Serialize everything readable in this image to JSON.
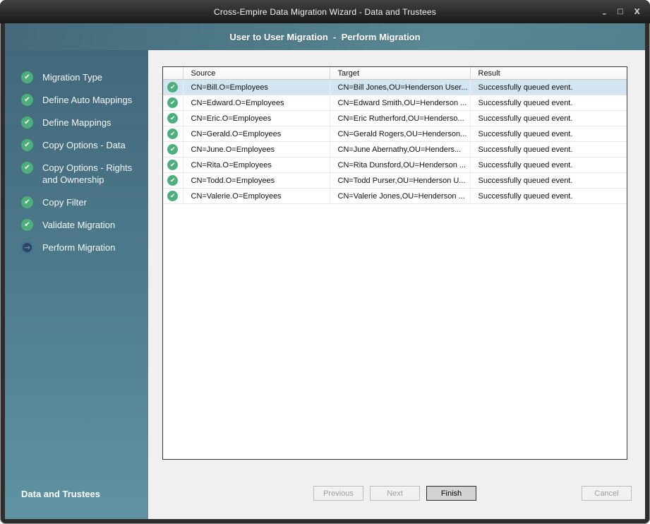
{
  "window": {
    "title": "Cross-Empire Data Migration Wizard - Data and Trustees",
    "controls": {
      "minimize": "–",
      "maximize": "□",
      "close": "X"
    }
  },
  "header": {
    "title": "User to User Migration  -  Perform Migration"
  },
  "sidebar": {
    "steps": [
      {
        "label": "Migration Type",
        "status": "complete"
      },
      {
        "label": "Define Auto Mappings",
        "status": "complete"
      },
      {
        "label": "Define Mappings",
        "status": "complete"
      },
      {
        "label": "Copy Options - Data",
        "status": "complete"
      },
      {
        "label": "Copy Options - Rights and Ownership",
        "status": "complete"
      },
      {
        "label": "Copy Filter",
        "status": "complete"
      },
      {
        "label": "Validate Migration",
        "status": "complete"
      },
      {
        "label": "Perform Migration",
        "status": "current"
      }
    ],
    "footer": "Data and Trustees"
  },
  "table": {
    "columns": [
      "",
      "Source",
      "Target",
      "Result"
    ],
    "rows": [
      {
        "status": "success",
        "selected": true,
        "source": "CN=Bill.O=Employees",
        "target": "CN=Bill Jones,OU=Henderson User...",
        "result": "Successfully queued event."
      },
      {
        "status": "success",
        "selected": false,
        "source": "CN=Edward.O=Employees",
        "target": "CN=Edward Smith,OU=Henderson ...",
        "result": "Successfully queued event."
      },
      {
        "status": "success",
        "selected": false,
        "source": "CN=Eric.O=Employees",
        "target": "CN=Eric Rutherford,OU=Henderso...",
        "result": "Successfully queued event."
      },
      {
        "status": "success",
        "selected": false,
        "source": "CN=Gerald.O=Employees",
        "target": "CN=Gerald Rogers,OU=Henderson...",
        "result": "Successfully queued event."
      },
      {
        "status": "success",
        "selected": false,
        "source": "CN=June.O=Employees",
        "target": "CN=June Abernathy,OU=Henders...",
        "result": "Successfully queued event."
      },
      {
        "status": "success",
        "selected": false,
        "source": "CN=Rita.O=Employees",
        "target": "CN=Rita Dunsford,OU=Henderson ...",
        "result": "Successfully queued event."
      },
      {
        "status": "success",
        "selected": false,
        "source": "CN=Todd.O=Employees",
        "target": "CN=Todd Purser,OU=Henderson U...",
        "result": "Successfully queued event."
      },
      {
        "status": "success",
        "selected": false,
        "source": "CN=Valerie.O=Employees",
        "target": "CN=Valerie Jones,OU=Henderson ...",
        "result": "Successfully queued event."
      }
    ]
  },
  "buttons": {
    "previous": "Previous",
    "next": "Next",
    "finish": "Finish",
    "cancel": "Cancel"
  },
  "colors": {
    "accent_teal": "#4e7d8d",
    "success_green": "#4daf7d",
    "current_step_blue": "#3f70a0",
    "selected_row": "#d3e5f0",
    "titlebar": "#222222",
    "pane_background": "#f0f0f0"
  }
}
